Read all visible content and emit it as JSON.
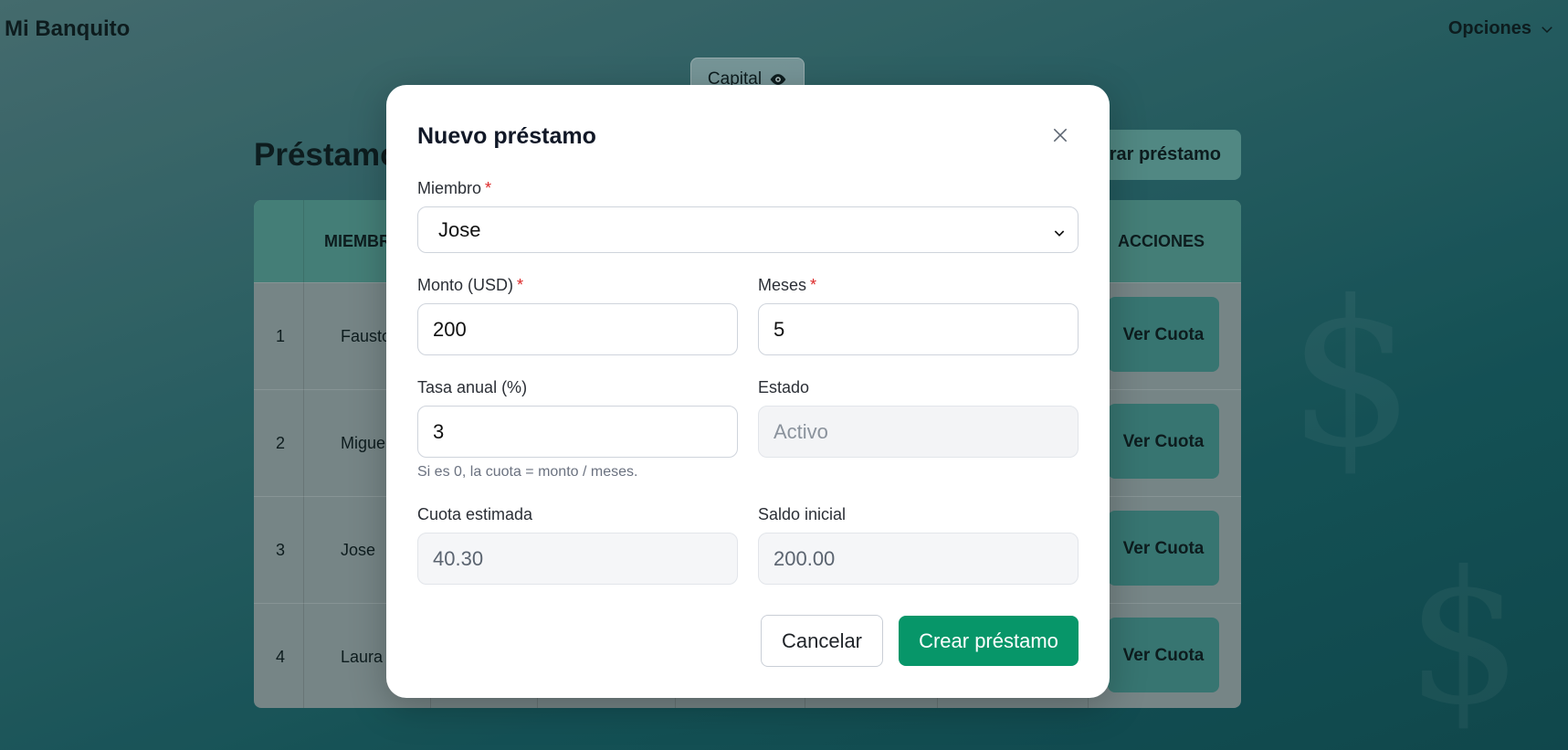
{
  "app": {
    "title": "Mi Banquito",
    "options_label": "Opciones"
  },
  "capital": {
    "label": "Capital"
  },
  "page": {
    "title": "Préstamos",
    "new_loan_button": "Registrar préstamo"
  },
  "table": {
    "headers": {
      "members": "MIEMBRO",
      "actions": "ACCIONES"
    },
    "rows": [
      {
        "num": "1",
        "name": "Fausto",
        "action": "Ver Cuota"
      },
      {
        "num": "2",
        "name": "Miguel",
        "action": "Ver Cuota"
      },
      {
        "num": "3",
        "name": "Jose",
        "action": "Ver Cuota"
      },
      {
        "num": "4",
        "name": "Laura",
        "action": "Ver Cuota"
      }
    ]
  },
  "modal": {
    "title": "Nuevo préstamo",
    "member": {
      "label": "Miembro",
      "required_mark": "*",
      "value": "Jose"
    },
    "amount": {
      "label": "Monto (USD)",
      "required_mark": "*",
      "value": "200"
    },
    "months": {
      "label": "Meses",
      "required_mark": "*",
      "value": "5"
    },
    "rate": {
      "label": "Tasa anual (%)",
      "value": "3",
      "hint": "Si es 0, la cuota = monto / meses."
    },
    "status": {
      "label": "Estado",
      "value": "Activo"
    },
    "installment": {
      "label": "Cuota estimada",
      "value": "40.30"
    },
    "initial_balance": {
      "label": "Saldo inicial",
      "value": "200.00"
    },
    "cancel_label": "Cancelar",
    "create_label": "Crear préstamo"
  },
  "colors": {
    "primary": "#079669",
    "accent": "#4f9288",
    "required": "#dc2626"
  }
}
